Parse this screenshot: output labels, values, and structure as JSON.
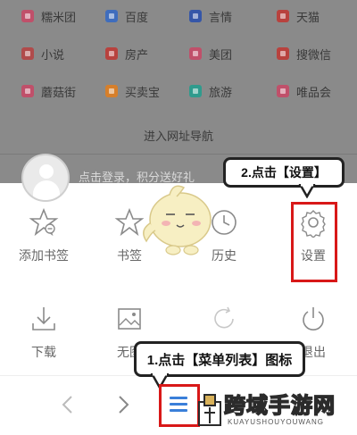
{
  "sites": [
    {
      "label": "糯米团",
      "color": "#c0506a"
    },
    {
      "label": "百度",
      "color": "#3f6dbd"
    },
    {
      "label": "言情",
      "color": "#3556a8"
    },
    {
      "label": "天猫",
      "color": "#b8423e"
    },
    {
      "label": "小说",
      "color": "#b04b4b"
    },
    {
      "label": "房产",
      "color": "#b8423e"
    },
    {
      "label": "美团",
      "color": "#c0506a"
    },
    {
      "label": "搜微信",
      "color": "#b8423e"
    },
    {
      "label": "蘑菇街",
      "color": "#c0506a"
    },
    {
      "label": "买卖宝",
      "color": "#d67f2b"
    },
    {
      "label": "旅游",
      "color": "#2f9b8d"
    },
    {
      "label": "唯品会",
      "color": "#c0506a"
    }
  ],
  "portal_hint": "进入网址导航",
  "login_text": "点击登录，积分送好礼",
  "menu": {
    "row1": [
      {
        "label": "添加书签",
        "icon": "add-bookmark-icon"
      },
      {
        "label": "书签",
        "icon": "bookmark-icon"
      },
      {
        "label": "历史",
        "icon": "history-icon"
      },
      {
        "label": "设置",
        "icon": "settings-gear-icon"
      }
    ],
    "row2": [
      {
        "label": "下载",
        "icon": "download-icon"
      },
      {
        "label": "无图",
        "icon": "no-image-icon"
      },
      {
        "label": "",
        "icon": "refresh-icon"
      },
      {
        "label": "退出",
        "icon": "power-icon"
      }
    ]
  },
  "callouts": {
    "step2": "2.点击【设置】",
    "step1": "1.点击【菜单列表】图标"
  },
  "watermark": {
    "title": "跨域手游网",
    "subtitle": "KUAYUSHOUYOUWANG"
  },
  "colors": {
    "accent_blue": "#3a7fd9",
    "annotation_red": "#d81818"
  }
}
